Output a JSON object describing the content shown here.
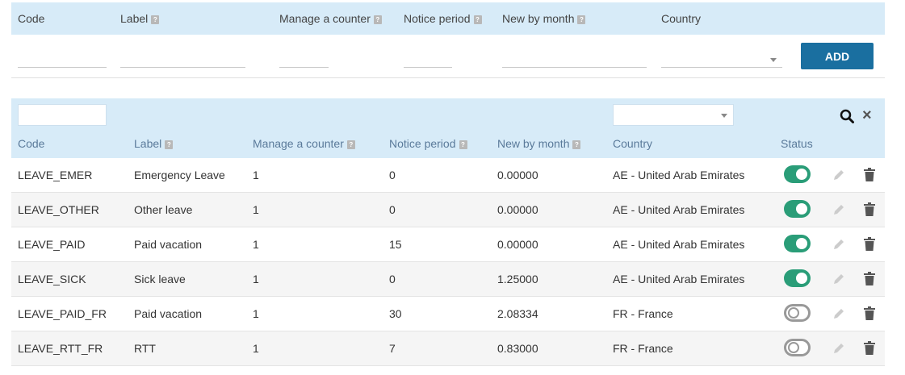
{
  "add_form": {
    "headers": {
      "code": "Code",
      "label": "Label",
      "counter": "Manage a counter",
      "notice": "Notice period",
      "monthly": "New by month",
      "country": "Country"
    },
    "help_glyph": "?",
    "add_button": "ADD"
  },
  "table": {
    "headers": {
      "code": "Code",
      "label": "Label",
      "counter": "Manage a counter",
      "notice": "Notice period",
      "monthly": "New by month",
      "country": "Country",
      "status": "Status"
    },
    "close_glyph": "×",
    "rows": [
      {
        "code": "LEAVE_EMER",
        "label": "Emergency Leave",
        "counter": "1",
        "notice": "0",
        "monthly": "0.00000",
        "country": "AE - United Arab Emirates",
        "active": true
      },
      {
        "code": "LEAVE_OTHER",
        "label": "Other leave",
        "counter": "1",
        "notice": "0",
        "monthly": "0.00000",
        "country": "AE - United Arab Emirates",
        "active": true
      },
      {
        "code": "LEAVE_PAID",
        "label": "Paid vacation",
        "counter": "1",
        "notice": "15",
        "monthly": "0.00000",
        "country": "AE - United Arab Emirates",
        "active": true
      },
      {
        "code": "LEAVE_SICK",
        "label": "Sick leave",
        "counter": "1",
        "notice": "0",
        "monthly": "1.25000",
        "country": "AE - United Arab Emirates",
        "active": true
      },
      {
        "code": "LEAVE_PAID_FR",
        "label": "Paid vacation",
        "counter": "1",
        "notice": "30",
        "monthly": "2.08334",
        "country": "FR - France",
        "active": false
      },
      {
        "code": "LEAVE_RTT_FR",
        "label": "RTT",
        "counter": "1",
        "notice": "7",
        "monthly": "0.83000",
        "country": "FR - France",
        "active": false
      }
    ]
  },
  "icons": {
    "help": "help-icon",
    "search": "search-icon",
    "close": "close-icon",
    "edit": "pencil-icon",
    "delete": "trash-icon",
    "dropdown": "chevron-down-icon"
  },
  "colors": {
    "header_bg": "#d7ebf8",
    "add_button": "#1a6fa0",
    "toggle_on": "#2a9d78",
    "toggle_off": "#999999"
  }
}
